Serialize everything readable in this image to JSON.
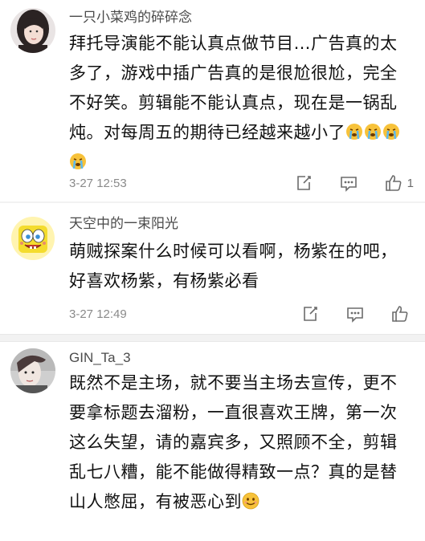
{
  "comments": [
    {
      "username": "一只小菜鸡的碎碎念",
      "text": "拜托导演能不能认真点做节目…广告真的太多了，游戏中插广告真的是很尬很尬，完全不好笑。剪辑能不能认真点，现在是一锅乱炖。对每周五的期待已经越来越小了",
      "emojis": [
        "crying-emoji",
        "crying-emoji",
        "crying-emoji",
        "crying-emoji"
      ],
      "time": "3-27 12:53",
      "likes": "1"
    },
    {
      "username": "天空中的一束阳光",
      "text": "萌贼探案什么时候可以看啊，杨紫在的吧，好喜欢杨紫，有杨紫必看",
      "time": "3-27 12:49",
      "likes": ""
    },
    {
      "username": "GIN_Ta_3",
      "text": "既然不是主场，就不要当主场去宣传，更不要拿标题去溜粉，一直很喜欢王牌，第一次这么失望，请的嘉宾多，又照顾不全，剪辑乱七八糟，能不能做得精致一点？真的是替山人憋屈，有被恶心到",
      "emojis": [
        "smile-emoji"
      ]
    }
  ],
  "colors": {
    "username": "#4a4a4a",
    "text": "#111111",
    "time": "#8a8a8a",
    "icon": "#6b6b6b",
    "divider": "#f2f2f2"
  }
}
